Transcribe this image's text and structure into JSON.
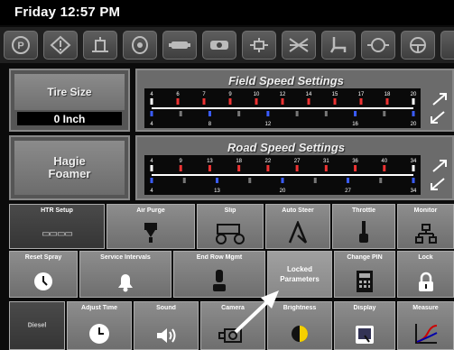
{
  "status": {
    "day_time": "Friday 12:57 PM"
  },
  "top_icons": [
    "parking-icon",
    "warning-icon",
    "hitch-icon",
    "engine-icon",
    "transmission-icon",
    "camera-rear-icon",
    "hydraulics-icon",
    "sprayer-boom-icon",
    "seat-icon",
    "pump-icon",
    "steering-wheel-icon"
  ],
  "tire_size": {
    "label": "Tire Size",
    "value": "0 Inch"
  },
  "field_speed": {
    "title": "Field Speed Settings",
    "top_ticks": [
      "4",
      "6",
      "7",
      "9",
      "10",
      "12",
      "14",
      "15",
      "17",
      "18",
      "20"
    ],
    "bottom_ticks": [
      "4",
      "",
      "8",
      "",
      "12",
      "",
      "",
      "16",
      "",
      "20"
    ]
  },
  "machine": {
    "label_line1": "Hagie",
    "label_line2": "Foamer"
  },
  "road_speed": {
    "title": "Road Speed Settings",
    "top_ticks": [
      "4",
      "9",
      "13",
      "18",
      "22",
      "27",
      "31",
      "36",
      "40",
      "34"
    ],
    "bottom_ticks": [
      "4",
      "",
      "13",
      "",
      "20",
      "",
      "27",
      "",
      "34"
    ]
  },
  "row1": [
    "HTR Setup",
    "Air Purge",
    "Slip",
    "Auto Steer",
    "Throttle",
    "Monitor"
  ],
  "row1_htr_glyph": "▭▭▭▭",
  "row2": [
    "Reset Spray",
    "Service Intervals",
    "End Row Mgmt",
    "Locked Parameters",
    "Change PIN",
    "Lock"
  ],
  "row2_locked_line1": "Locked",
  "row2_locked_line2": "Parameters",
  "row3": [
    "Diesel",
    "Adjust Time",
    "Sound",
    "Camera",
    "Brightness",
    "Display",
    "Measure"
  ]
}
